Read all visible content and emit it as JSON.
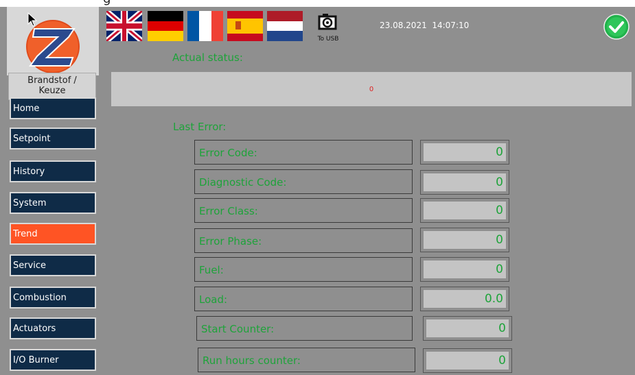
{
  "window": {
    "title_fragment": "g"
  },
  "logo": {
    "letter": "Z"
  },
  "brand_button": {
    "label_line1": "Brandstof /",
    "label_line2": "Keuze"
  },
  "nav": [
    {
      "label": "Home",
      "active": false
    },
    {
      "label": "Setpoint",
      "active": false
    },
    {
      "label": "History",
      "active": false
    },
    {
      "label": "System",
      "active": false
    },
    {
      "label": "Trend",
      "active": true
    },
    {
      "label": "Service",
      "active": false
    },
    {
      "label": "Combustion",
      "active": false
    },
    {
      "label": "Actuators",
      "active": false
    },
    {
      "label": "I/O Burner",
      "active": false
    }
  ],
  "languages": [
    "english-flag",
    "german-flag",
    "french-flag",
    "spanish-flag",
    "dutch-flag"
  ],
  "usb": {
    "label": "To USB",
    "icon": "camera-icon"
  },
  "datetime": {
    "date": "23.08.2021",
    "time": "14:07:10"
  },
  "status_icon": "check-icon",
  "actual_status": {
    "title": "Actual status:",
    "value": "0"
  },
  "last_error": {
    "title": "Last Error:",
    "fields": [
      {
        "label": "Error Code:",
        "value": "0"
      },
      {
        "label": "Diagnostic Code:",
        "value": "0"
      },
      {
        "label": "Error Class:",
        "value": "0"
      },
      {
        "label": "Error Phase:",
        "value": "0"
      },
      {
        "label": "Fuel:",
        "value": "0"
      },
      {
        "label": "Load:",
        "value": "0.0"
      },
      {
        "label": "Start Counter:",
        "value": "0"
      },
      {
        "label": "Run hours counter:",
        "value": "0"
      }
    ]
  },
  "colors": {
    "background": "#8f8f8f",
    "nav": "#0f2b47",
    "nav_active": "#ff5424",
    "accent_text": "#1ea33a",
    "ok": "#22b24c"
  }
}
